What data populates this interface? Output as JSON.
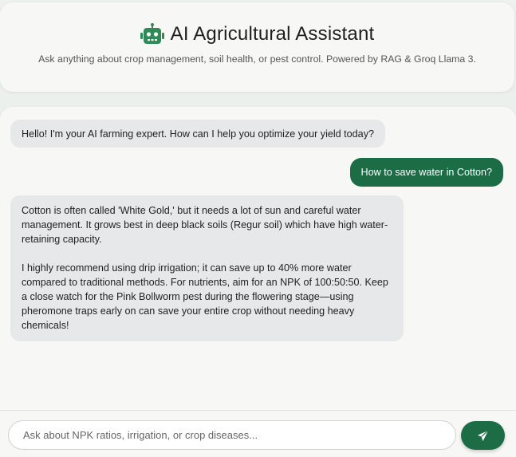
{
  "header": {
    "icon": "robot-icon",
    "title": "AI Agricultural Assistant",
    "subtitle": "Ask anything about crop management, soil health, or pest control. Powered by RAG & Groq Llama 3."
  },
  "messages": [
    {
      "role": "assistant",
      "text": "Hello! I'm your AI farming expert. How can I help you optimize your yield today?"
    },
    {
      "role": "user",
      "text": "How to save water in Cotton?"
    },
    {
      "role": "assistant",
      "paragraphs": [
        "Cotton is often called 'White Gold,' but it needs a lot of sun and careful water management. It grows best in deep black soils (Regur soil) which have high water-retaining capacity.",
        "I highly recommend using drip irrigation; it can save up to 40% more water compared to traditional methods. For nutrients, aim for an NPK of 100:50:50. Keep a close watch for the Pink Bollworm pest during the flowering stage—using pheromone traps early on can save your entire crop without needing heavy chemicals!"
      ]
    }
  ],
  "input": {
    "placeholder": "Ask about NPK ratios, irrigation, or crop diseases...",
    "value": ""
  },
  "send_button": {
    "icon": "paper-plane-icon"
  },
  "colors": {
    "accent": "#1c6d46",
    "ai_bubble": "#e6e8ea",
    "robot_icon": "#2e8b57"
  }
}
